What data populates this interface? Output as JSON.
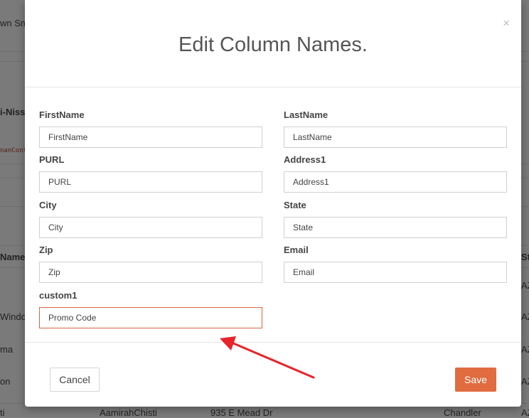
{
  "background": {
    "top_left_text": "wn Sm",
    "heading_partial": "i-Nissa",
    "code_partial": "nanCont",
    "col_name_header": "Name",
    "col_st_header": "St",
    "rows_left": [
      "Windo",
      "ma",
      "on",
      "ti"
    ],
    "rows_right": [
      "AZ",
      "AZ",
      "AZ",
      "AZ"
    ],
    "bottom_row": {
      "name": "AamirahChisti",
      "address": "935 E Mead Dr",
      "city": "Chandler",
      "state": "AZ"
    }
  },
  "modal": {
    "title": "Edit Column Names.",
    "close_symbol": "×",
    "fields": [
      {
        "label": "FirstName",
        "value": "FirstName"
      },
      {
        "label": "LastName",
        "value": "LastName"
      },
      {
        "label": "PURL",
        "value": "PURL"
      },
      {
        "label": "Address1",
        "value": "Address1"
      },
      {
        "label": "City",
        "value": "City"
      },
      {
        "label": "State",
        "value": "State"
      },
      {
        "label": "Zip",
        "value": "Zip"
      },
      {
        "label": "Email",
        "value": "Email"
      },
      {
        "label": "custom1",
        "value": "Promo Code"
      }
    ],
    "cancel_label": "Cancel",
    "save_label": "Save"
  },
  "colors": {
    "accent": "#e06c40",
    "focus_border": "#d9663f",
    "annotation_arrow": "#e8232a"
  }
}
